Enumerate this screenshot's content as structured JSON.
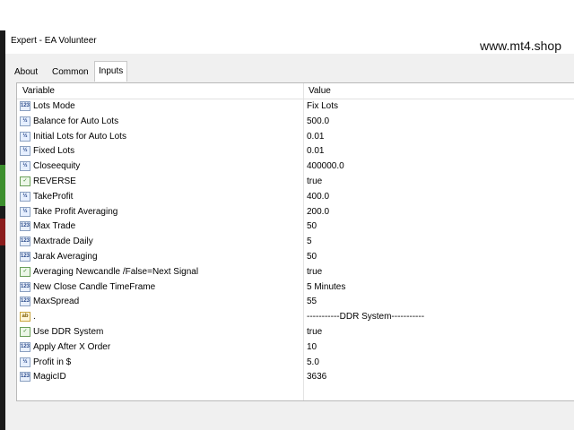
{
  "window": {
    "title": "Expert - EA Volunteer"
  },
  "watermark": "www.mt4.shop",
  "tabs": [
    {
      "label": "About",
      "active": false
    },
    {
      "label": "Common",
      "active": false
    },
    {
      "label": "Inputs",
      "active": true
    }
  ],
  "table": {
    "headers": {
      "variable": "Variable",
      "value": "Value"
    },
    "rows": [
      {
        "icon": "123",
        "name": "Lots Mode",
        "value": "Fix Lots"
      },
      {
        "icon": "½",
        "name": "Balance for Auto Lots",
        "value": "500.0"
      },
      {
        "icon": "½",
        "name": "Initial Lots for Auto Lots",
        "value": "0.01"
      },
      {
        "icon": "½",
        "name": "Fixed Lots",
        "value": "0.01"
      },
      {
        "icon": "½",
        "name": "Closeequity",
        "value": "400000.0"
      },
      {
        "icon": "bool",
        "name": "REVERSE",
        "value": "true"
      },
      {
        "icon": "½",
        "name": "TakeProfit",
        "value": "400.0"
      },
      {
        "icon": "½",
        "name": "Take Profit Averaging",
        "value": "200.0"
      },
      {
        "icon": "123",
        "name": "Max Trade",
        "value": "50"
      },
      {
        "icon": "123",
        "name": "Maxtrade Daily",
        "value": "5"
      },
      {
        "icon": "123",
        "name": "Jarak Averaging",
        "value": "50"
      },
      {
        "icon": "bool",
        "name": "Averaging Newcandle /False=Next Signal",
        "value": "true"
      },
      {
        "icon": "123",
        "name": "New Close Candle TimeFrame",
        "value": "5 Minutes"
      },
      {
        "icon": "123",
        "name": "MaxSpread",
        "value": "55"
      },
      {
        "icon": "ab",
        "name": ".",
        "value": "-----------DDR System-----------"
      },
      {
        "icon": "bool",
        "name": "Use DDR System",
        "value": "true"
      },
      {
        "icon": "123",
        "name": "Apply After X Order",
        "value": "10"
      },
      {
        "icon": "½",
        "name": "Profit in $",
        "value": "5.0"
      },
      {
        "icon": "123",
        "name": "MagicID",
        "value": "3636"
      }
    ]
  }
}
